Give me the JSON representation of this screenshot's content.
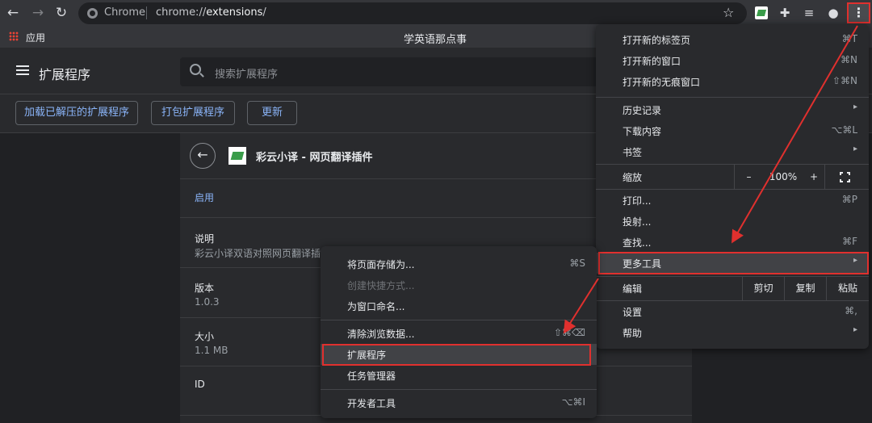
{
  "toolbar": {
    "back_icon": "back-arrow-icon",
    "forward_icon": "forward-arrow-icon",
    "reload_icon": "reload-icon",
    "site_label": "Chrome",
    "url_prefix": "chrome://",
    "url_host": "extensions",
    "url_suffix": "/",
    "menu_icon": "three-dots-icon"
  },
  "bookmarks": {
    "apps_label": "应用"
  },
  "window_title": "学英语那点事",
  "extensions_page": {
    "title": "扩展程序",
    "search_placeholder": "搜索扩展程序",
    "dev_buttons": [
      "加载已解压的扩展程序",
      "打包扩展程序",
      "更新"
    ],
    "detail": {
      "name": "彩云小译 - 网页翻译插件",
      "enabled_label": "启用",
      "description_label": "说明",
      "description_value": "彩云小译双语对照网页翻译插",
      "version_label": "版本",
      "version_value": "1.0.3",
      "size_label": "大小",
      "size_value": "1.1 MB",
      "id_label": "ID"
    }
  },
  "main_menu": {
    "items": [
      {
        "label": "打开新的标签页",
        "shortcut": "⌘T"
      },
      {
        "label": "打开新的窗口",
        "shortcut": "⌘N"
      },
      {
        "label": "打开新的无痕窗口",
        "shortcut": "⇧⌘N"
      },
      {
        "label": "历史记录",
        "shortcut": "▸"
      },
      {
        "label": "下载内容",
        "shortcut": "⌥⌘L"
      },
      {
        "label": "书签",
        "shortcut": "▸"
      },
      {
        "label": "打印...",
        "shortcut": "⌘P"
      },
      {
        "label": "投射...",
        "shortcut": ""
      },
      {
        "label": "查找...",
        "shortcut": "⌘F"
      },
      {
        "label": "更多工具",
        "shortcut": "▸"
      },
      {
        "label": "设置",
        "shortcut": "⌘,"
      },
      {
        "label": "帮助",
        "shortcut": "▸"
      }
    ],
    "zoom": {
      "label": "缩放",
      "minus": "–",
      "value": "100%",
      "plus": "+"
    },
    "edit": {
      "label": "编辑",
      "cut": "剪切",
      "copy": "复制",
      "paste": "粘贴"
    }
  },
  "sub_menu": {
    "items": [
      {
        "label": "将页面存储为...",
        "shortcut": "⌘S"
      },
      {
        "label": "创建快捷方式...",
        "shortcut": ""
      },
      {
        "label": "为窗口命名...",
        "shortcut": ""
      },
      {
        "label": "清除浏览数据...",
        "shortcut": "⇧⌘⌫"
      },
      {
        "label": "扩展程序",
        "shortcut": ""
      },
      {
        "label": "任务管理器",
        "shortcut": ""
      },
      {
        "label": "开发者工具",
        "shortcut": "⌥⌘I"
      }
    ]
  },
  "colors": {
    "highlight": "#e0302e",
    "link": "#8ab4f8",
    "background": "#202124"
  }
}
